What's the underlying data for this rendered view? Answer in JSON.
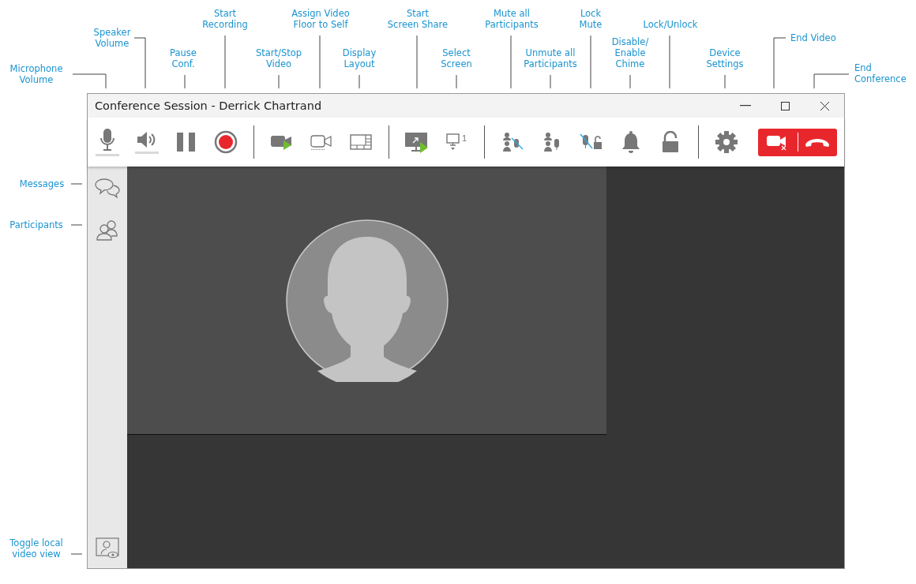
{
  "callouts": [
    {
      "lines": [
        "Microphone",
        "Volume"
      ]
    },
    {
      "lines": [
        "Speaker",
        "Volume"
      ]
    },
    {
      "lines": [
        "Pause",
        "Conf."
      ]
    },
    {
      "lines": [
        "Start",
        "Recording"
      ]
    },
    {
      "lines": [
        "Start/Stop",
        "Video"
      ]
    },
    {
      "lines": [
        "Assign Video",
        "Floor to Self"
      ]
    },
    {
      "lines": [
        "Display",
        "Layout"
      ]
    },
    {
      "lines": [
        "Start",
        "Screen Share"
      ]
    },
    {
      "lines": [
        "Select",
        "Screen"
      ]
    },
    {
      "lines": [
        "Mute all",
        "Participants"
      ]
    },
    {
      "lines": [
        "Unmute all",
        "Participants"
      ]
    },
    {
      "lines": [
        "Lock",
        "Mute"
      ]
    },
    {
      "lines": [
        "Disable/",
        "Enable",
        "Chime"
      ]
    },
    {
      "lines": [
        "Lock/Unlock"
      ]
    },
    {
      "lines": [
        "Device",
        "Settings"
      ]
    },
    {
      "lines": [
        "End Video"
      ]
    },
    {
      "lines": [
        "End",
        "Conference"
      ]
    },
    {
      "lines": [
        "Messages"
      ]
    },
    {
      "lines": [
        "Participants"
      ]
    },
    {
      "lines": [
        "Toggle local",
        "video view"
      ]
    }
  ],
  "window": {
    "title": "Conference Session - Derrick Chartrand"
  },
  "toolbar": {
    "screen_number": "1"
  }
}
